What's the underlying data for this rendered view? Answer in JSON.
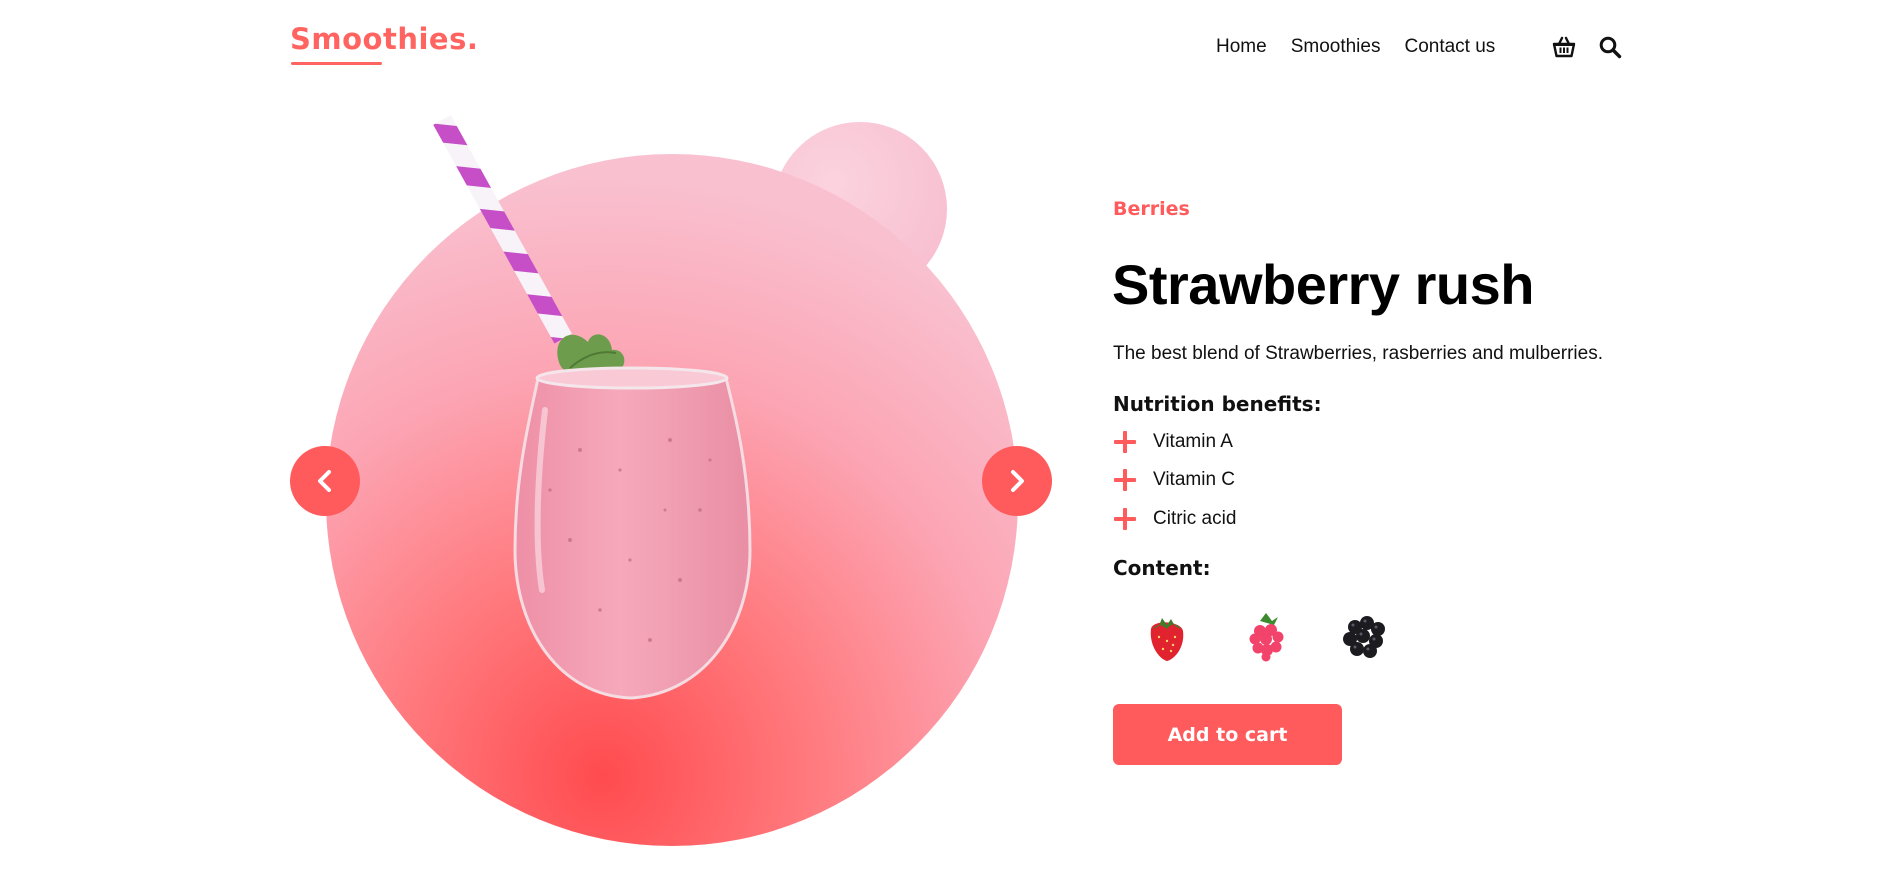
{
  "brand": {
    "logo": "Smoothies."
  },
  "nav": {
    "home": "Home",
    "smoothies": "Smoothies",
    "contact": "Contact us"
  },
  "icons": {
    "cart": "basket-icon",
    "search": "search-icon",
    "prev": "chevron-left-icon",
    "next": "chevron-right-icon",
    "benefit": "plus-icon"
  },
  "product": {
    "category": "Berries",
    "title": "Strawberry rush",
    "description": "The best blend of Strawberries, rasberries and mulberries.",
    "nutrition_heading": "Nutrition benefits:",
    "benefits": [
      "Vitamin A",
      "Vitamin C",
      "Citric acid"
    ],
    "content_heading": "Content:",
    "content_items": [
      "strawberry",
      "raspberry",
      "blackberry"
    ],
    "add_to_cart": "Add to cart"
  },
  "colors": {
    "accent": "#ff5a5c",
    "logo": "#ff6461",
    "circle_pink": "#fac6d4",
    "text": "#111111"
  }
}
